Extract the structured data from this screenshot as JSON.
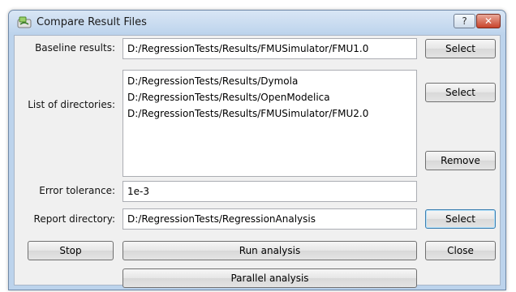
{
  "window": {
    "title": "Compare Result Files",
    "help_label": "?",
    "close_label": "✕"
  },
  "baseline": {
    "label": "Baseline results:",
    "value": "D:/RegressionTests/Results/FMUSimulator/FMU1.0",
    "select_label": "Select"
  },
  "directories": {
    "label": "List of directories:",
    "items": [
      "D:/RegressionTests/Results/Dymola",
      "D:/RegressionTests/Results/OpenModelica",
      "D:/RegressionTests/Results/FMUSimulator/FMU2.0"
    ],
    "select_label": "Select",
    "remove_label": "Remove"
  },
  "tolerance": {
    "label": "Error tolerance:",
    "value": "1e-3"
  },
  "report": {
    "label": "Report directory:",
    "value": "D:/RegressionTests/RegressionAnalysis",
    "select_label": "Select"
  },
  "actions": {
    "stop_label": "Stop",
    "run_label": "Run analysis",
    "close_label": "Close",
    "parallel_label": "Parallel analysis"
  }
}
